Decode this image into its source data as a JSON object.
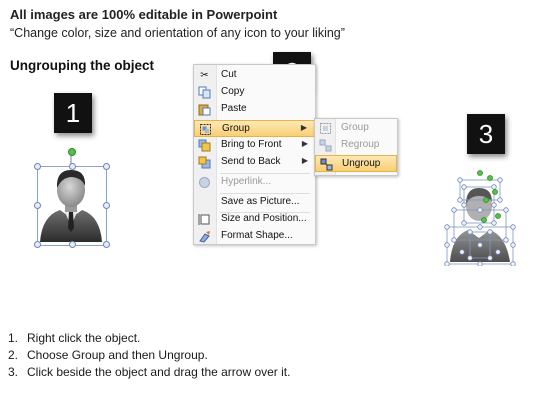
{
  "header": {
    "title": "All images are 100% editable in Powerpoint",
    "subtitle": "“Change color, size and orientation of any icon to your liking”"
  },
  "section_title": "Ungrouping the object",
  "badges": [
    "1",
    "2",
    "3"
  ],
  "context_menu": {
    "items": [
      {
        "label": "Cut",
        "icon": "scissors-icon"
      },
      {
        "label": "Copy",
        "icon": "copy-icon"
      },
      {
        "label": "Paste",
        "icon": "paste-icon"
      },
      {
        "label": "Group",
        "icon": "group-icon",
        "highlighted": true,
        "submenu": true
      },
      {
        "label": "Bring to Front",
        "icon": "bring-front-icon",
        "submenu": true
      },
      {
        "label": "Send to Back",
        "icon": "send-back-icon",
        "submenu": true
      },
      {
        "label": "Hyperlink...",
        "icon": "hyperlink-icon",
        "disabled": true
      },
      {
        "label": "Save as Picture...",
        "icon": ""
      },
      {
        "label": "Size and Position...",
        "icon": "size-position-icon"
      },
      {
        "label": "Format Shape...",
        "icon": "format-shape-icon"
      }
    ]
  },
  "submenu": {
    "items": [
      {
        "label": "Group",
        "icon": "group-icon",
        "disabled": true
      },
      {
        "label": "Regroup",
        "icon": "regroup-icon",
        "disabled": true
      },
      {
        "label": "Ungroup",
        "icon": "ungroup-icon",
        "highlighted": true
      }
    ]
  },
  "steps": [
    {
      "num": "1.",
      "text": "Right click the object."
    },
    {
      "num": "2.",
      "text": "Choose Group and then Ungroup."
    },
    {
      "num": "3.",
      "text": "Click beside the object and drag the arrow over it."
    }
  ],
  "colors": {
    "menu_highlight": "#f8cf74",
    "selection_handle": "#6e86b4",
    "rotation_handle": "#55c04a",
    "badge": "#111111"
  }
}
